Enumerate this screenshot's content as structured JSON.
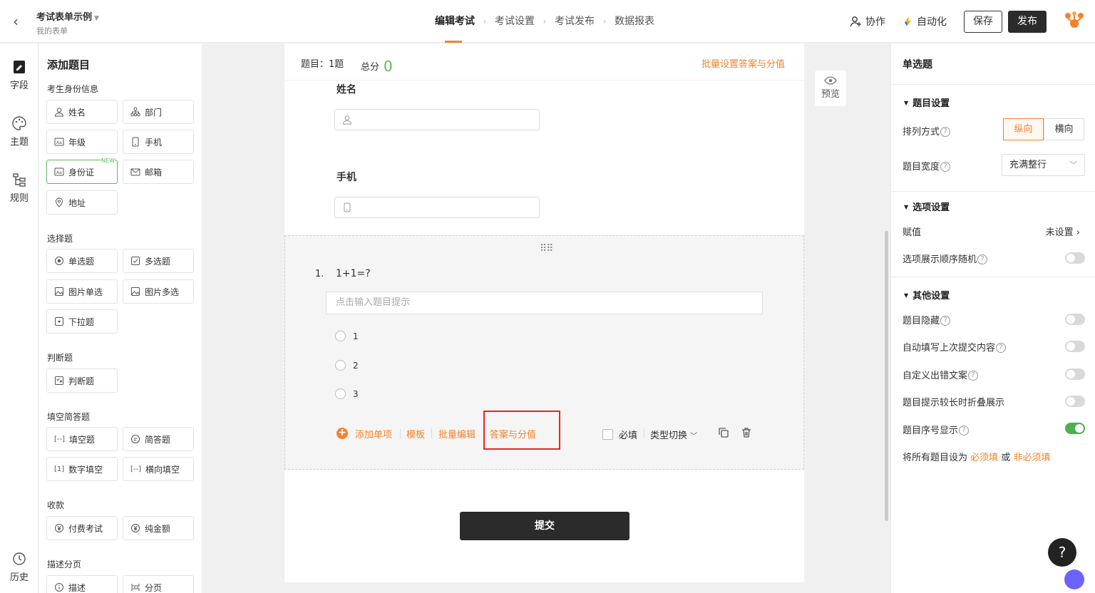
{
  "header": {
    "form_title": "考试表单示例",
    "form_subtitle": "我的表单",
    "steps": [
      "编辑考试",
      "考试设置",
      "考试发布",
      "数据报表"
    ],
    "collaborate": "协作",
    "automation": "自动化",
    "save": "保存",
    "publish": "发布"
  },
  "rail": {
    "fields": "字段",
    "theme": "主题",
    "rules": "规则",
    "history": "历史"
  },
  "fieldpanel": {
    "title": "添加题目",
    "groups": {
      "identity": "考生身份信息",
      "choice": "选择题",
      "judge": "判断题",
      "fill": "填空简答题",
      "payment": "收款",
      "desc": "描述分页"
    },
    "items": {
      "name": "姓名",
      "dept": "部门",
      "grade": "年级",
      "phone": "手机",
      "idcard": "身份证",
      "email": "邮箱",
      "address": "地址",
      "single": "单选题",
      "multi": "多选题",
      "img_single": "图片单选",
      "img_multi": "图片多选",
      "dropdown": "下拉题",
      "judge": "判断题",
      "blank": "填空题",
      "short": "简答题",
      "num_blank": "数字填空",
      "h_blank": "横向填空",
      "paid": "付费考试",
      "amount": "纯金额",
      "describe": "描述",
      "page": "分页"
    },
    "new_badge": "NEW"
  },
  "paper": {
    "count_label": "题目：1题",
    "score_label": "总分",
    "score_value": "0",
    "batch_link": "批量设置答案与分值",
    "name_label": "姓名",
    "phone_label": "手机",
    "question_no": "1.",
    "question_text": "1+1=?",
    "hint_placeholder": "点击输入题目提示",
    "options": [
      "1",
      "2",
      "3"
    ],
    "actions": {
      "add": "添加单项",
      "template": "模板",
      "batch_edit": "批量编辑",
      "answer_score": "答案与分值",
      "required": "必填",
      "switch_type": "类型切换"
    },
    "submit": "提交",
    "preview": "预览"
  },
  "rpanel": {
    "title": "单选题",
    "sec_question": "题目设置",
    "layout_label": "排列方式",
    "layout_vertical": "纵向",
    "layout_horizontal": "横向",
    "width_label": "题目宽度",
    "width_value": "充满整行",
    "sec_options": "选项设置",
    "value_label": "赋值",
    "value_state": "未设置",
    "random_label": "选项展示顺序随机",
    "sec_other": "其他设置",
    "hide_label": "题目隐藏",
    "autofill_label": "自动填写上次提交内容",
    "custom_error_label": "自定义出错文案",
    "collapse_label": "题目提示较长时折叠展示",
    "seq_label": "题目序号显示",
    "all_prefix": "将所有题目设为",
    "all_required": "必须填",
    "all_or": "或",
    "all_optional": "非必须填"
  },
  "toggles": {
    "random": false,
    "hide": false,
    "autofill": false,
    "custom_error": false,
    "collapse": false,
    "seq": true
  },
  "colors": {
    "accent": "#f5822a",
    "success": "#4caf50",
    "dark": "#2b2b2b"
  },
  "help_glyph": "?"
}
